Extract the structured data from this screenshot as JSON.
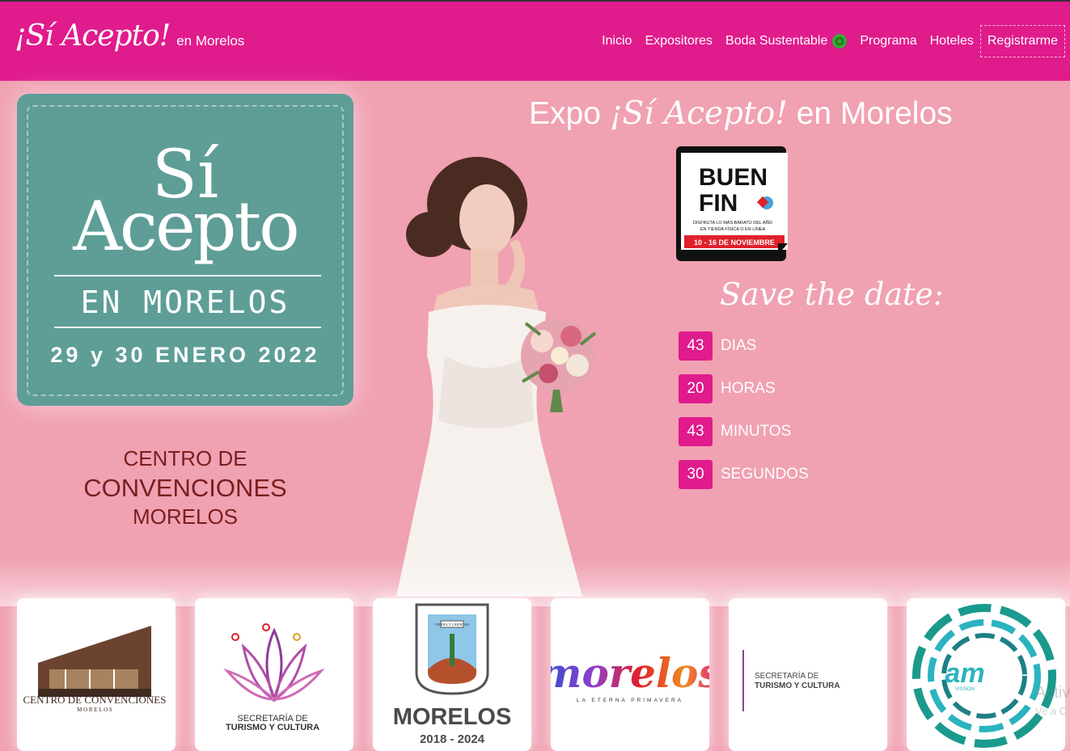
{
  "brand": {
    "script": "¡Sí Acepto!",
    "sub": "en Morelos"
  },
  "nav": {
    "items": [
      "Inicio",
      "Expositores",
      "Boda Sustentable",
      "Programa",
      "Hoteles"
    ],
    "register": "Registrarme",
    "recycle_icon": "recycle-icon"
  },
  "poster": {
    "si": "Sí",
    "acepto": "Acepto",
    "city": "EN MORELOS",
    "date": "29 y 30 ENERO 2022"
  },
  "venue": {
    "line1": "CENTRO DE",
    "line2": "CONVENCIONES",
    "line3": "MORELOS"
  },
  "expo": {
    "prefix": "Expo",
    "script": "¡Sí Acepto!",
    "suffix": "en Morelos"
  },
  "buenfin": {
    "line1": "BUEN",
    "line2": "FIN",
    "tagline1": "DISFRUTA LO MÁS BARATO DEL AÑO",
    "tagline2": "EN TIENDA FÍSICA O EN LÍNEA",
    "dates": "10 - 16 DE NOVIEMBRE"
  },
  "save_date": "Save the date:",
  "countdown": [
    {
      "value": "43",
      "label": "DIAS"
    },
    {
      "value": "20",
      "label": "HORAS"
    },
    {
      "value": "43",
      "label": "MINUTOS"
    },
    {
      "value": "30",
      "label": "SEGUNDOS"
    }
  ],
  "sponsors": {
    "centro": {
      "name": "CENTRO DE CONVENCIONES",
      "sub": "M O R E L O S"
    },
    "turismo": {
      "line1": "SECRETARÍA DE",
      "line2": "TURISMO Y CULTURA"
    },
    "gobierno": {
      "name": "MORELOS",
      "period": "2018 - 2024",
      "motto": "TIERRA Y LIBERTAD"
    },
    "marca": {
      "name": "morelos",
      "tagline": "LA ETERNA PRIMAVERA"
    },
    "turismo2": {
      "line1": "SECRETARÍA DE",
      "line2": "TURISMO Y CULTURA"
    },
    "am": {
      "name": "am",
      "sub": "VISSION"
    }
  },
  "watermark": {
    "line1": "Activ",
    "line2": "Ve a C"
  },
  "colors": {
    "magenta": "#e01b8c",
    "pink_bg": "#f0a1b2",
    "teal": "#5e9e97",
    "venue": "#7a1e1e"
  }
}
